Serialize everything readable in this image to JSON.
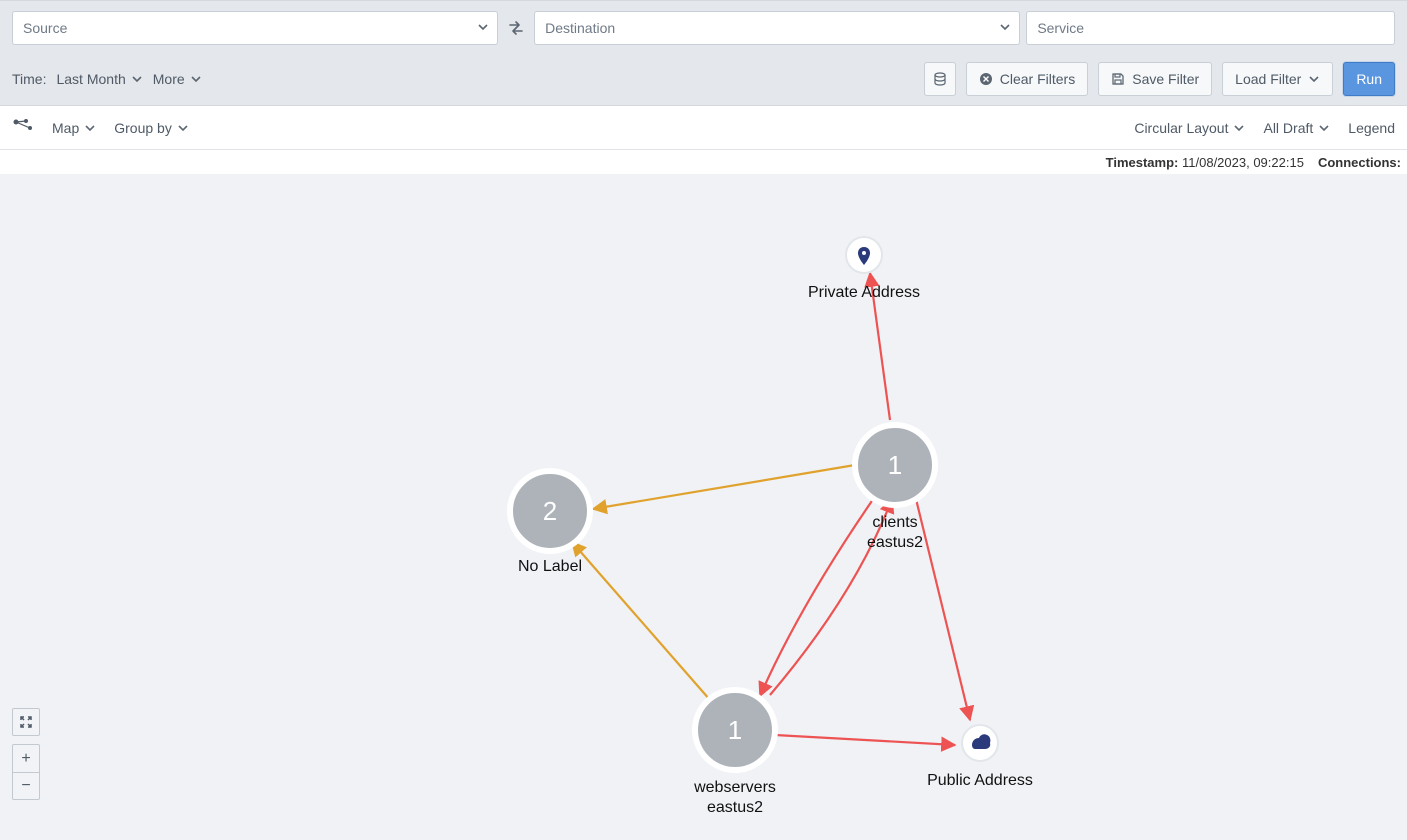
{
  "filters": {
    "source": {
      "placeholder": "Source"
    },
    "destination": {
      "placeholder": "Destination"
    },
    "service": {
      "placeholder": "Service"
    }
  },
  "actions": {
    "time_label": "Time:",
    "time_value": "Last Month",
    "more": "More",
    "clear_filters": "Clear Filters",
    "save_filter": "Save Filter",
    "load_filter": "Load Filter",
    "run": "Run"
  },
  "view": {
    "map": "Map",
    "group_by": "Group by",
    "layout": "Circular Layout",
    "draft": "All Draft",
    "legend": "Legend"
  },
  "status": {
    "timestamp_label": "Timestamp:",
    "timestamp": "11/08/2023, 09:22:15",
    "connections_label": "Connections:"
  },
  "graph": {
    "nodes": {
      "nolabel": {
        "count": "2",
        "label": "No Label"
      },
      "clients": {
        "count": "1",
        "label1": "clients",
        "label2": "eastus2"
      },
      "webservers": {
        "count": "1",
        "label1": "webservers",
        "label2": "eastus2"
      },
      "private": {
        "label": "Private Address"
      },
      "public": {
        "label": "Public Address"
      }
    }
  },
  "map_controls": {
    "fullscreen": "⛶",
    "zoom_in": "+",
    "zoom_out": "−"
  }
}
